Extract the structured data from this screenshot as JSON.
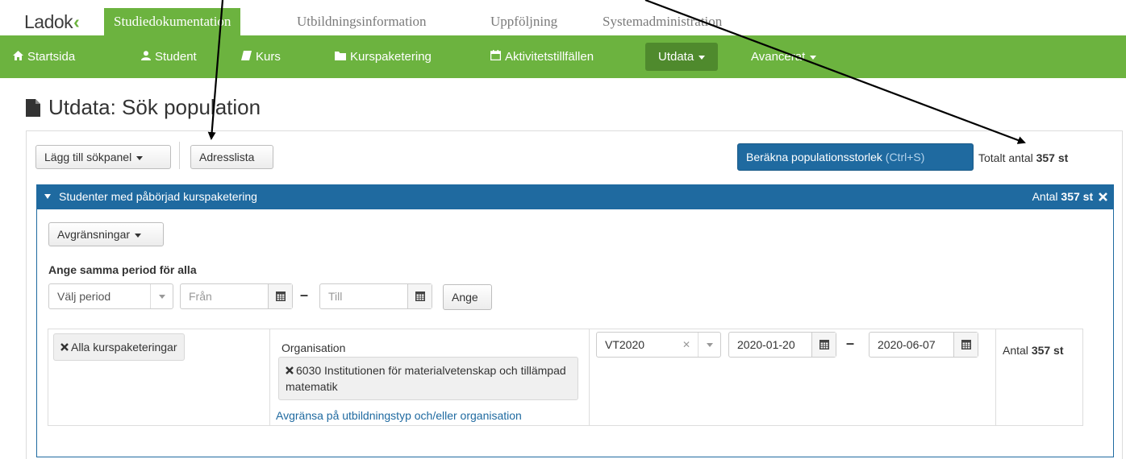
{
  "brand": {
    "logo": "Ladok",
    "accent": "#6cb33f",
    "primary": "#1f6aa0"
  },
  "main_tabs": [
    {
      "label": "Studiedokumentation",
      "active": true
    },
    {
      "label": "Utbildningsinformation",
      "active": false
    },
    {
      "label": "Uppföljning",
      "active": false
    },
    {
      "label": "Systemadministration",
      "active": false
    }
  ],
  "nav": [
    {
      "label": "Startsida",
      "icon": "home-icon"
    },
    {
      "label": "Student",
      "icon": "user-icon"
    },
    {
      "label": "Kurs",
      "icon": "book-icon"
    },
    {
      "label": "Kurspaketering",
      "icon": "folder-icon"
    },
    {
      "label": "Aktivitetstillfällen",
      "icon": "calendar-icon"
    },
    {
      "label": "Utdata",
      "icon": "caret-down-icon",
      "active": true
    },
    {
      "label": "Avancerat",
      "icon": "caret-down-icon"
    }
  ],
  "page": {
    "title": "Utdata: Sök population",
    "icon": "document-icon"
  },
  "toolbar": {
    "add_panel": "Lägg till sökpanel",
    "address_list": "Adresslista",
    "calculate": "Beräkna populationsstorlek",
    "calculate_hint": "(Ctrl+S)",
    "total_prefix": "Totalt antal",
    "total_value": "357 st"
  },
  "panel": {
    "title": "Studenter med påbörjad kurspaketering",
    "count_prefix": "Antal",
    "count_value": "357 st",
    "restrictions": "Avgränsningar",
    "same_period_label": "Ange samma period för alla",
    "select_period_placeholder": "Välj period",
    "from_placeholder": "Från",
    "to_placeholder": "Till",
    "apply": "Ange"
  },
  "row": {
    "all_packages": "Alla kurspaketeringar",
    "org_label": "Organisation",
    "org_chip": "6030 Institutionen för materialvetenskap och tillämpad matematik",
    "limit_link": "Avgränsa på utbildningstyp och/eller organisation",
    "period": "VT2020",
    "from_date": "2020-01-20",
    "to_date": "2020-06-07",
    "count_prefix": "Antal",
    "count_value": "357 st"
  }
}
